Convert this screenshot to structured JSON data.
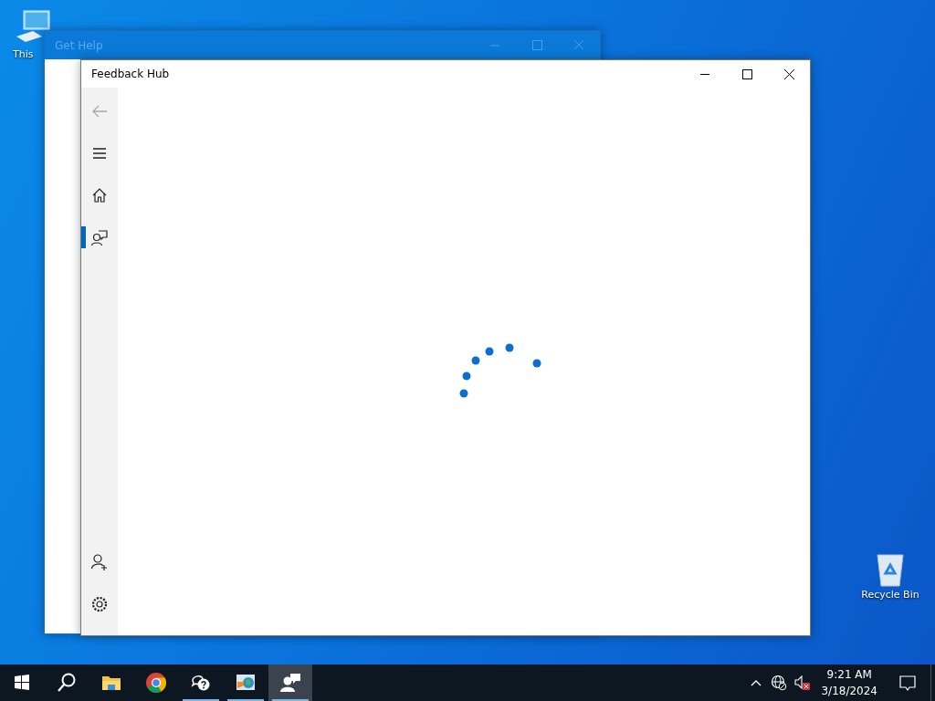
{
  "desktop_icons": [
    {
      "kind": "computer",
      "label": "This"
    },
    {
      "kind": "recycle",
      "label": "Recycle Bin"
    }
  ],
  "background_window": {
    "title": "Get Help",
    "active": false
  },
  "window": {
    "title": "Feedback Hub",
    "active": true,
    "loading": true
  },
  "sidebar": {
    "items": [
      {
        "kind": "back",
        "disabled": true,
        "selected": false
      },
      {
        "kind": "menu",
        "disabled": false,
        "selected": false
      },
      {
        "kind": "home",
        "disabled": false,
        "selected": false
      },
      {
        "kind": "feedback",
        "disabled": false,
        "selected": true
      }
    ],
    "bottom_items": [
      {
        "kind": "add-account",
        "disabled": false,
        "selected": false
      },
      {
        "kind": "settings",
        "disabled": false,
        "selected": false
      }
    ]
  },
  "taskbar": {
    "apps": [
      {
        "kind": "start",
        "running": false,
        "selected": false
      },
      {
        "kind": "search",
        "running": false,
        "selected": false
      },
      {
        "kind": "files",
        "running": false,
        "selected": false
      },
      {
        "kind": "browser",
        "running": false,
        "selected": false
      },
      {
        "kind": "help",
        "running": true,
        "selected": false
      },
      {
        "kind": "control",
        "running": true,
        "selected": false
      },
      {
        "kind": "feedback",
        "running": true,
        "selected": true
      }
    ],
    "tray": {
      "time": "9:21 AM",
      "date": "3/18/2024",
      "muted": true,
      "network_disconnected": true
    }
  }
}
